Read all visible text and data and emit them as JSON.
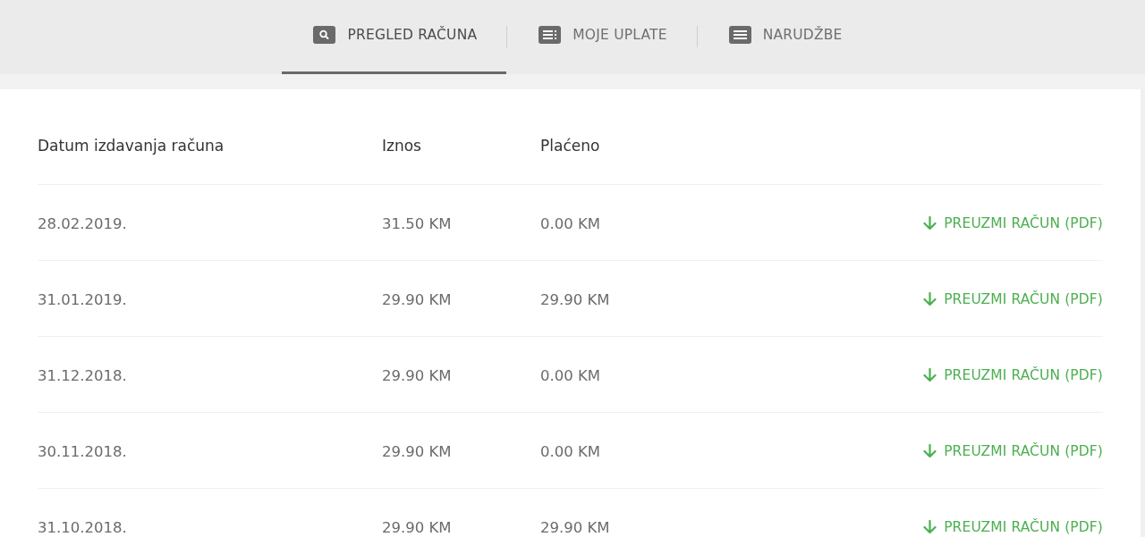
{
  "tabs": [
    {
      "label": "PREGLED RAČUNA",
      "kind": "search",
      "selected": true
    },
    {
      "label": "MOJE UPLATE",
      "kind": "list",
      "selected": false
    },
    {
      "label": "NARUDŽBE",
      "kind": "lines",
      "selected": false
    }
  ],
  "table": {
    "columns": [
      "Datum izdavanja računa",
      "Iznos",
      "Plaćeno"
    ],
    "rows": [
      {
        "date": "28.02.2019.",
        "amount": "31.50 KM",
        "paid": "0.00 KM",
        "action": "PREUZMI RAČUN (PDF)"
      },
      {
        "date": "31.01.2019.",
        "amount": "29.90 KM",
        "paid": "29.90 KM",
        "action": "PREUZMI RAČUN (PDF)"
      },
      {
        "date": "31.12.2018.",
        "amount": "29.90 KM",
        "paid": "0.00 KM",
        "action": "PREUZMI RAČUN (PDF)"
      },
      {
        "date": "30.11.2018.",
        "amount": "29.90 KM",
        "paid": "0.00 KM",
        "action": "PREUZMI RAČUN (PDF)"
      },
      {
        "date": "31.10.2018.",
        "amount": "29.90 KM",
        "paid": "29.90 KM",
        "action": "PREUZMI RAČUN (PDF)"
      }
    ]
  }
}
